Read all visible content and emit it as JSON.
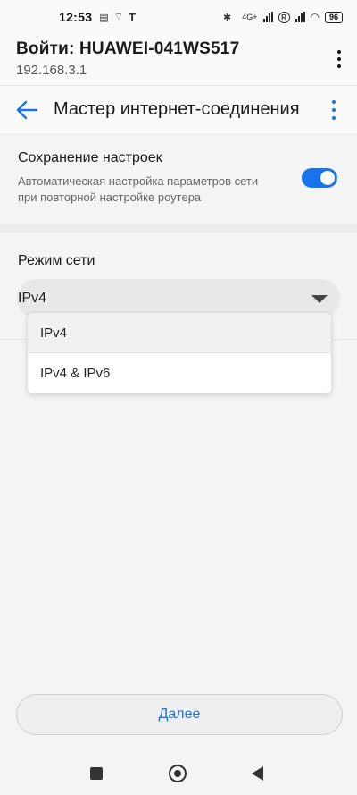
{
  "status_bar": {
    "time": "12:53",
    "network_label": "4G+",
    "battery": "96"
  },
  "browser": {
    "title": "Войти: HUAWEI-041WS517",
    "url": "192.168.3.1"
  },
  "app_bar": {
    "title": "Мастер интернет-соединения"
  },
  "save_settings": {
    "title": "Сохранение настроек",
    "description": "Автоматическая настройка параметров сети при повторной настройке роутера",
    "enabled": true
  },
  "network_mode": {
    "label": "Режим сети",
    "selected": "IPv4",
    "options": [
      "IPv4",
      "IPv4 & IPv6"
    ]
  },
  "footer": {
    "next_label": "Далее"
  },
  "colors": {
    "accent": "#1a73e8",
    "background": "#f4f4f4"
  }
}
